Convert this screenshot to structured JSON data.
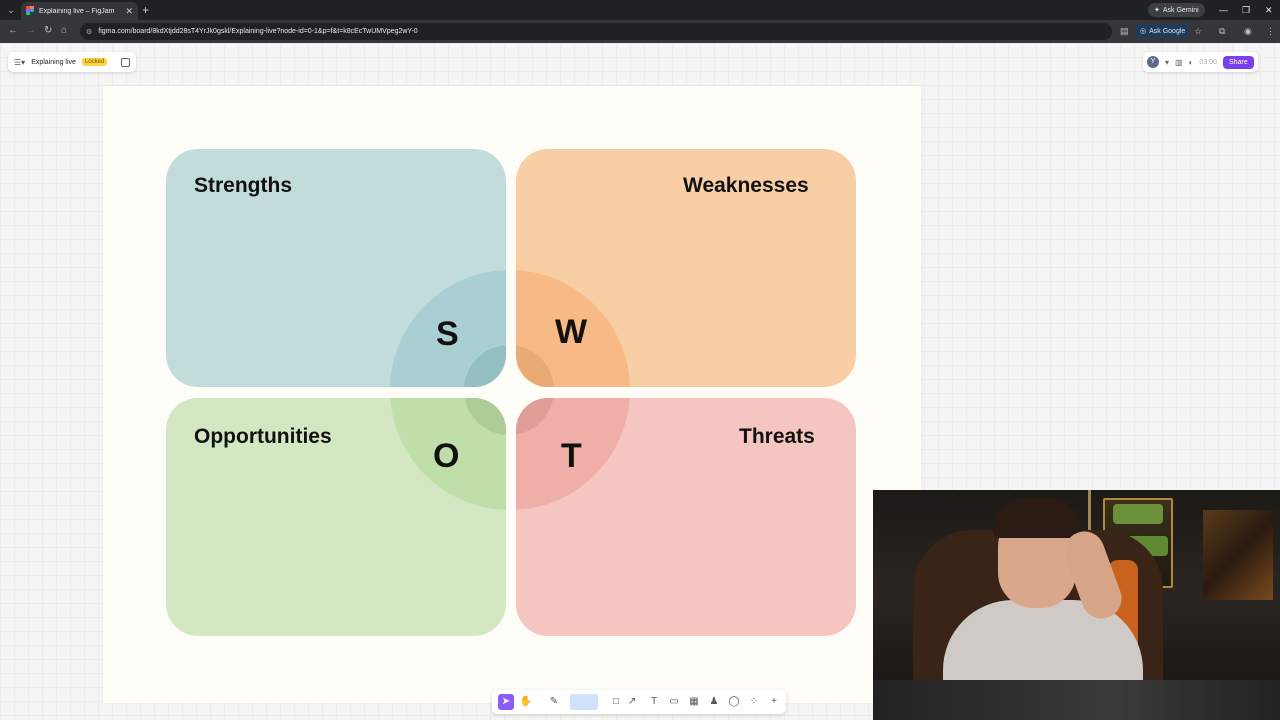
{
  "browser": {
    "tab_title": "Explaining live – FigJam",
    "url": "figma.com/board/8kdXtjdd28sT4YrJk0gskl/Explaining-live?node-id=0-1&p=f&t=k8cEcTwUMVpeg2wY-0",
    "ask_gemini": "Ask Gemini",
    "ask_google": "Ask Google"
  },
  "figma": {
    "file_name": "Explaining live",
    "locked_label": "Locked",
    "avatar_initial": "Y",
    "timer": "03:00",
    "share_label": "Share"
  },
  "swot": {
    "strengths": {
      "label": "Strengths",
      "letter": "S",
      "color": "#c2dcdc"
    },
    "weaknesses": {
      "label": "Weaknesses",
      "letter": "W",
      "color": "#f8cfa5"
    },
    "opportunities": {
      "label": "Opportunities",
      "letter": "O",
      "color": "#d4e7c3"
    },
    "threats": {
      "label": "Threats",
      "letter": "T",
      "color": "#f5c5bf"
    }
  },
  "colors": {
    "accent": "#7b3ff2",
    "locked_badge": "#ffd23f",
    "browser_bg": "#202124"
  },
  "toolbar": {
    "tools": [
      "move-tool",
      "hand-tool",
      "marker-tool",
      "highlighter-tool",
      "shape-tool",
      "connector-tool",
      "text-tool",
      "section-tool",
      "table-tool",
      "stamp-tool",
      "comment-tool",
      "widgets-tool",
      "more-tool"
    ]
  }
}
